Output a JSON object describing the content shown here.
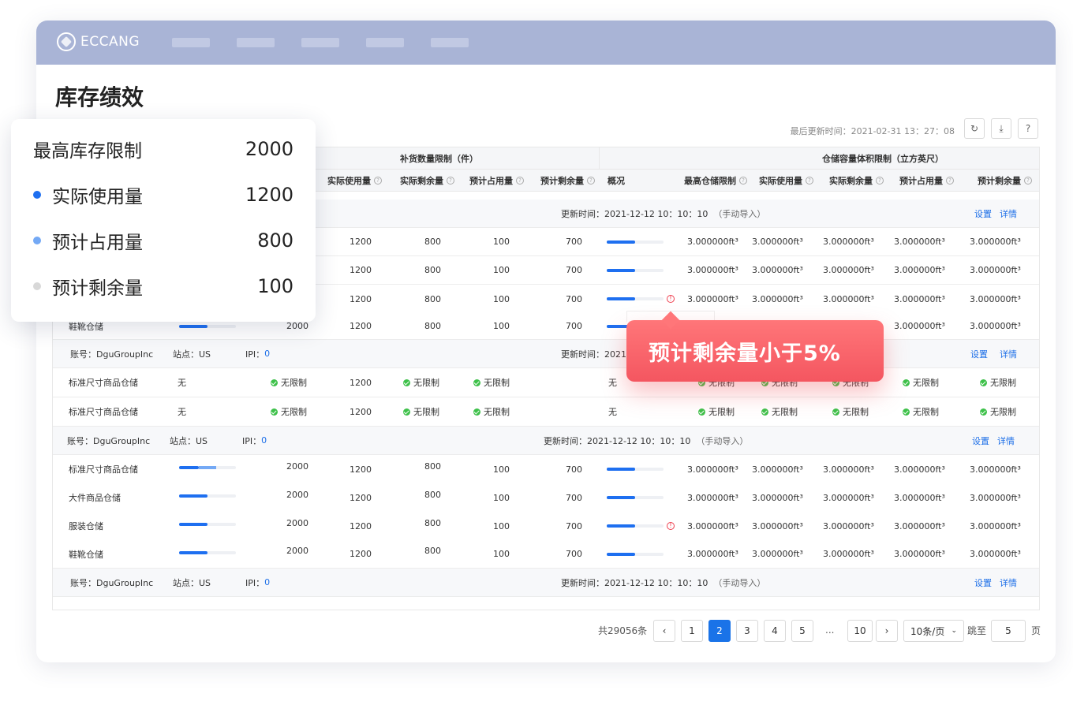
{
  "app": {
    "logo_text": "ECCANG"
  },
  "page": {
    "title": "库存绩效"
  },
  "toolbar": {
    "last_update_label": "最后更新时间：",
    "last_update_value": "2021-02-31 13：27：08"
  },
  "table": {
    "group_headers": {
      "replenish": "补货数量限制（件）",
      "storage": "仓储容量体积限制（立方英尺）"
    },
    "columns": {
      "actual_used": "实际使用量",
      "actual_left": "实际剩余量",
      "est_occupy": "预计占用量",
      "est_left": "预计剩余量",
      "overview": "概况",
      "max_storage": "最高仓储限制",
      "s_actual_used": "实际使用量",
      "s_actual_left": "实际剩余量",
      "s_est_occupy": "预计占用量",
      "s_est_left": "预计剩余量"
    },
    "groups": [
      {
        "update": "更新时间：2021-12-12  10：10：10",
        "note": "（手动导入）",
        "set": "设置",
        "detail": "详情"
      },
      {
        "account": "账号：DguGroupInc",
        "site": "站点：US",
        "ipi_label": "IPI：",
        "ipi": "0",
        "update": "更新时间：2021-",
        "set": "设置",
        "detail": "详情"
      },
      {
        "account": "账号：DguGroupInc",
        "site": "站点：US",
        "ipi_label": "IPI：",
        "ipi": "0",
        "update": "更新时间：2021-12-12  10：10：10",
        "note": "（手动导入）",
        "set": "设置",
        "detail": "详情"
      },
      {
        "account": "账号：DguGroupInc",
        "site": "站点：US",
        "ipi_label": "IPI：",
        "ipi": "0",
        "update": "更新时间：2021-12-12  10：10：10",
        "note": "（手动导入）",
        "set": "设置",
        "detail": "详情"
      }
    ],
    "rows_a": [
      {
        "name": "",
        "max": "",
        "used": "1200",
        "left": "800",
        "occ": "100",
        "est": "700",
        "fill": 0.5,
        "warn": false,
        "vol": [
          "3.000000ft³",
          "3.000000ft³",
          "3.000000ft³",
          "3.000000ft³",
          "3.000000ft³"
        ]
      },
      {
        "name": "",
        "max": "",
        "used": "1200",
        "left": "800",
        "occ": "100",
        "est": "700",
        "fill": 0.5,
        "warn": false,
        "vol": [
          "3.000000ft³",
          "3.000000ft³",
          "3.000000ft³",
          "3.000000ft³",
          "3.000000ft³"
        ]
      },
      {
        "name": "",
        "max": "",
        "used": "1200",
        "left": "800",
        "occ": "100",
        "est": "700",
        "fill": 0.5,
        "warn": true,
        "vol": [
          "3.000000ft³",
          "3.000000ft³",
          "3.000000ft³",
          "3.000000ft³",
          "3.000000ft³"
        ]
      },
      {
        "name": "鞋靴仓储",
        "max": "2000",
        "used": "1200",
        "left": "800",
        "occ": "100",
        "est": "700",
        "fill": 0.5,
        "warn": false,
        "vol": [
          "",
          "",
          "",
          "3.000000ft³",
          "3.000000ft³"
        ]
      }
    ],
    "rows_b": [
      {
        "name": "标准尺寸商品仓储",
        "limit": "无",
        "unlimited": "无限制",
        "used": "1200",
        "overview": "无"
      },
      {
        "name": "标准尺寸商品仓储",
        "limit": "无",
        "unlimited": "无限制",
        "used": "1200",
        "overview": "无"
      }
    ],
    "rows_c": [
      {
        "name": "标准尺寸商品仓储",
        "max": "2000",
        "used": "1200",
        "left": "800",
        "occ": "100",
        "est": "700",
        "fill": 0.35,
        "extra": 0.3,
        "warn": false,
        "vol": [
          "3.000000ft³",
          "3.000000ft³",
          "3.000000ft³",
          "3.000000ft³",
          "3.000000ft³"
        ]
      },
      {
        "name": "大件商品仓储",
        "max": "2000",
        "used": "1200",
        "left": "800",
        "occ": "100",
        "est": "700",
        "fill": 0.5,
        "extra": 0,
        "warn": false,
        "vol": [
          "3.000000ft³",
          "3.000000ft³",
          "3.000000ft³",
          "3.000000ft³",
          "3.000000ft³"
        ]
      },
      {
        "name": "服装仓储",
        "max": "2000",
        "used": "1200",
        "left": "800",
        "occ": "100",
        "est": "700",
        "fill": 0.5,
        "extra": 0,
        "warn": true,
        "vol": [
          "3.000000ft³",
          "3.000000ft³",
          "3.000000ft³",
          "3.000000ft³",
          "3.000000ft³"
        ]
      },
      {
        "name": "鞋靴仓储",
        "max": "2000",
        "used": "1200",
        "left": "800",
        "occ": "100",
        "est": "700",
        "fill": 0.5,
        "extra": 0,
        "warn": false,
        "vol": [
          "3.000000ft³",
          "3.000000ft³",
          "3.000000ft³",
          "3.000000ft³",
          "3.000000ft³"
        ]
      }
    ]
  },
  "pagination": {
    "total": "共29056条",
    "pages": [
      "1",
      "2",
      "3",
      "4",
      "5"
    ],
    "ellipsis": "...",
    "last": "10",
    "current": "2",
    "page_size": "10条/页",
    "jump_label": "跳至",
    "jump_value": "5",
    "page_suffix": "页",
    "prev": "‹",
    "next": "›"
  },
  "legend": {
    "items": [
      {
        "label": "最高库存限制",
        "value": "2000",
        "color": ""
      },
      {
        "label": "实际使用量",
        "value": "1200",
        "color": "#1e6ff0"
      },
      {
        "label": "预计占用量",
        "value": "800",
        "color": "#74a9f5"
      },
      {
        "label": "预计剩余量",
        "value": "100",
        "color": "#d8d8d8"
      }
    ]
  },
  "tooltip": {
    "text": "预计剩余量小于5%"
  },
  "colors": {
    "accent": "#1a73e8",
    "topbar": "#a9b4d6",
    "warning": "#f45660",
    "ok": "#3ec14a"
  }
}
